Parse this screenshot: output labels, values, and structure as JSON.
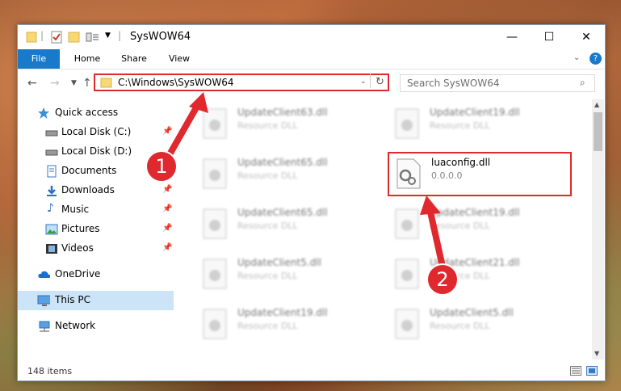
{
  "window": {
    "title": "SysWOW64",
    "buttons": {
      "minimize": "—",
      "maximize": "☐",
      "close": "✕"
    }
  },
  "ribbon": {
    "tabs": [
      "File",
      "Home",
      "Share",
      "View"
    ]
  },
  "address": {
    "path": "C:\\Windows\\SysWOW64",
    "search_placeholder": "Search SysWOW64"
  },
  "sidebar": {
    "items": [
      {
        "label": "Quick access",
        "icon": "star-icon"
      },
      {
        "label": "Local Disk (C:)",
        "icon": "drive-icon",
        "pinned": true
      },
      {
        "label": "Local Disk (D:)",
        "icon": "drive-icon"
      },
      {
        "label": "Documents",
        "icon": "documents-icon"
      },
      {
        "label": "Downloads",
        "icon": "downloads-icon",
        "pinned": true
      },
      {
        "label": "Music",
        "icon": "music-icon",
        "pinned": true
      },
      {
        "label": "Pictures",
        "icon": "pictures-icon",
        "pinned": true
      },
      {
        "label": "Videos",
        "icon": "videos-icon",
        "pinned": true
      },
      {
        "label": "OneDrive",
        "icon": "cloud-icon"
      },
      {
        "label": "This PC",
        "icon": "pc-icon",
        "selected": true
      },
      {
        "label": "Network",
        "icon": "network-icon"
      }
    ]
  },
  "files": {
    "left": [
      {
        "name": "UpdateClient63.dll",
        "desc": "Resource DLL"
      },
      {
        "name": "UpdateClient65.dll",
        "desc": "Resource DLL"
      },
      {
        "name": "UpdateClient65.dll",
        "desc": "Resource DLL"
      },
      {
        "name": "UpdateClient5.dll",
        "desc": "Resource DLL"
      },
      {
        "name": "UpdateClient19.dll",
        "desc": "Resource DLL"
      }
    ],
    "right": [
      {
        "name": "UpdateClient19.dll",
        "desc": "Resource DLL"
      },
      {
        "name": "luaconfig.dll",
        "desc": "0.0.0.0",
        "highlight": true
      },
      {
        "name": "UpdateClient19.dll",
        "desc": "Resource DLL"
      },
      {
        "name": "UpdateClient21.dll",
        "desc": "Resource DLL"
      },
      {
        "name": "UpdateClient5.dll",
        "desc": "Resource DLL"
      }
    ]
  },
  "status": {
    "item_count": "148 items"
  },
  "annotations": {
    "step1": "1",
    "step2": "2"
  },
  "colors": {
    "accent": "#1979ca",
    "highlight": "#e0282f"
  }
}
